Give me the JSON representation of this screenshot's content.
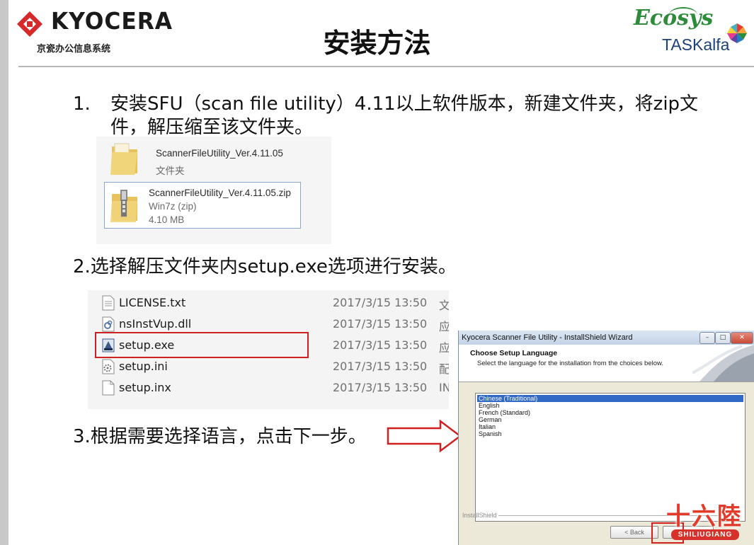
{
  "header": {
    "brand": "KYOCERA",
    "brand_sub": "京瓷办公信息系统",
    "title": "安装方法",
    "ecosys": "Ecosys",
    "taskalfa": "TASKalfa"
  },
  "steps": {
    "step1_number": "1.",
    "step1_line1": "安装SFU（scan file utility）4.11以上软件版本，新建文件夹，将zip文",
    "step1_line2": "件，解压缩至该文件夹。",
    "step2": "2.选择解压文件夹内setup.exe选项进行安装。",
    "step3": "3.根据需要选择语言，点击下一步。"
  },
  "explorer1": {
    "folder_name": "ScannerFileUtility_Ver.4.11.05",
    "folder_type": "文件夹",
    "zip_name": "ScannerFileUtility_Ver.4.11.05.zip",
    "zip_type": "Win7z (zip)",
    "zip_size": "4.10 MB"
  },
  "explorer2": {
    "files": [
      {
        "name": "LICENSE.txt",
        "date": "2017/3/15 13:50",
        "type": "文",
        "icon": "text-file-icon"
      },
      {
        "name": "nsInstVup.dll",
        "date": "2017/3/15 13:50",
        "type": "应",
        "icon": "dll-file-icon"
      },
      {
        "name": "setup.exe",
        "date": "2017/3/15 13:50",
        "type": "应",
        "icon": "installer-exe-icon"
      },
      {
        "name": "setup.ini",
        "date": "2017/3/15 13:50",
        "type": "配",
        "icon": "settings-file-icon"
      },
      {
        "name": "setup.inx",
        "date": "2017/3/15 13:50",
        "type": "IN",
        "icon": "blank-file-icon"
      }
    ]
  },
  "dialog": {
    "title": "Kyocera Scanner File Utility - InstallShield Wizard",
    "heading": "Choose Setup Language",
    "subheading": "Select the language for the installation from the choices below.",
    "languages": [
      "Chinese (Traditional)",
      "English",
      "French (Standard)",
      "German",
      "Italian",
      "Spanish"
    ],
    "selected_language": "Chinese (Traditional)",
    "installshield_label": "InstallShield",
    "back_button": "< Back",
    "next_button": "Ne"
  },
  "watermark": {
    "text": "十六陸",
    "sub": "SHILIUGIANG"
  },
  "colors": {
    "highlight_red": "#d02020",
    "kyocera_red": "#d62a2a",
    "selection_blue": "#3169c6"
  }
}
